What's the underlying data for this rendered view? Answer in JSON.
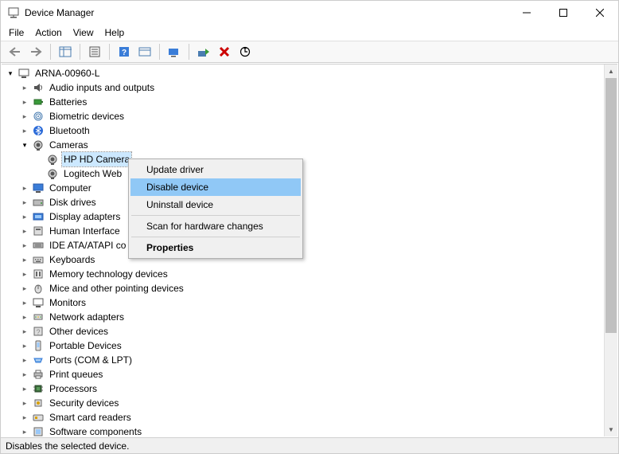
{
  "window": {
    "title": "Device Manager"
  },
  "menu": {
    "file": "File",
    "action": "Action",
    "view": "View",
    "help": "Help"
  },
  "status": {
    "text": "Disables the selected device."
  },
  "tree": {
    "root": "ARNA-00960-L",
    "nodes": {
      "audio": "Audio inputs and outputs",
      "batteries": "Batteries",
      "biometric": "Biometric devices",
      "bluetooth": "Bluetooth",
      "cameras": "Cameras",
      "hp_cam": "HP HD Camera",
      "logi_cam": "Logitech Web",
      "computer": "Computer",
      "disk": "Disk drives",
      "display": "Display adapters",
      "hid": "Human Interface",
      "ide": "IDE ATA/ATAPI co",
      "keyboards": "Keyboards",
      "memtech": "Memory technology devices",
      "mice": "Mice and other pointing devices",
      "monitors": "Monitors",
      "network": "Network adapters",
      "other": "Other devices",
      "portable": "Portable Devices",
      "ports": "Ports (COM & LPT)",
      "print": "Print queues",
      "processors": "Processors",
      "security": "Security devices",
      "smartcard": "Smart card readers",
      "softcomp": "Software components"
    }
  },
  "context_menu": {
    "update": "Update driver",
    "disable": "Disable device",
    "uninstall": "Uninstall device",
    "scan": "Scan for hardware changes",
    "properties": "Properties"
  }
}
